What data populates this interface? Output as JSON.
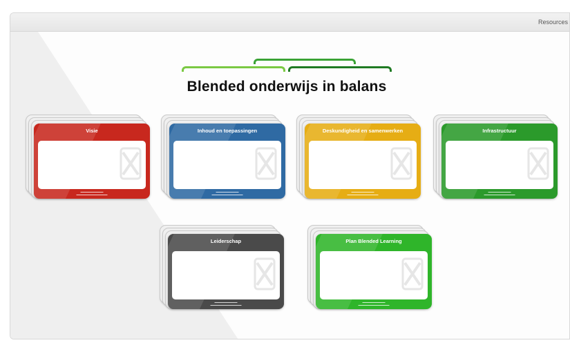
{
  "toolbar": {
    "resources_label": "Resources"
  },
  "page": {
    "title": "Blended onderwijs in balans"
  },
  "colors": {
    "arc_left": "#7ac943",
    "arc_middle": "#3aa335",
    "arc_right": "#1f7a23"
  },
  "cards": [
    {
      "label": "Visie",
      "color": "#c8281e",
      "icon": "logo-watermark-icon"
    },
    {
      "label": "Inhoud en toepassingen",
      "color": "#2f6aa3",
      "icon": "logo-watermark-icon"
    },
    {
      "label": "Deskundigheid en samenwerken",
      "color": "#e6ad14",
      "icon": "logo-watermark-icon"
    },
    {
      "label": "Infrastructuur",
      "color": "#2b9a2b",
      "icon": "logo-watermark-icon"
    },
    {
      "label": "Leiderschap",
      "color": "#4a4a4a",
      "icon": "logo-watermark-icon"
    },
    {
      "label": "Plan Blended Learning",
      "color": "#2fb52a",
      "icon": "logo-watermark-icon"
    }
  ]
}
